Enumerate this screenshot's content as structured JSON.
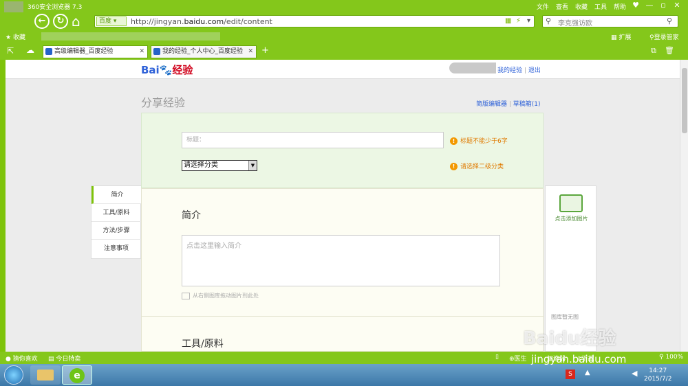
{
  "browser": {
    "title": "360安全浏览器 7.3",
    "menu": [
      "文件",
      "查看",
      "收藏",
      "工具",
      "帮助"
    ],
    "search_engine": "百度",
    "url_prefix": "http://jingyan.",
    "url_domain": "baidu.com",
    "url_suffix": "/edit/content",
    "search_query": "李克强访欧",
    "favorites_label": "收藏",
    "ext_label": "扩展",
    "login_label": "登录管家",
    "tabs": [
      {
        "label": "高级编辑器_百度经验"
      },
      {
        "label": "我的经验_个人中心_百度经验"
      }
    ]
  },
  "page": {
    "logo_text_1": "Bai",
    "logo_text_2": "经验",
    "user_links": {
      "my": "我的经验",
      "sep": "|",
      "logout": "退出"
    },
    "heading": "分享经验",
    "links": {
      "simple_editor": "简版编辑器",
      "drafts": "草稿箱(1)"
    },
    "title_placeholder": "标题：",
    "title_warning": "标题不能少于6字",
    "category_select": "请选择分类",
    "category_warning": "请选择二级分类",
    "side_nav": [
      "简介",
      "工具/原料",
      "方法/步骤",
      "注意事项"
    ],
    "intro_heading": "简介",
    "intro_placeholder": "点击这里输入简介",
    "drag_hint": "从右侧图库拖动图片到此处",
    "tools_heading": "工具/原料",
    "add_image_label": "点击添加图片",
    "gallery_empty": "图库暂无图"
  },
  "status": {
    "left_1": "猜你喜欢",
    "left_2": "今日特卖",
    "doctor": "医生",
    "accelerate": "加速器",
    "download": "下载",
    "zoom": "100%"
  },
  "taskbar": {
    "time": "14:27",
    "date": "2015/7/2"
  },
  "watermark": {
    "line1": "Baidu经验",
    "line2": "jingyan.baidu.com"
  }
}
